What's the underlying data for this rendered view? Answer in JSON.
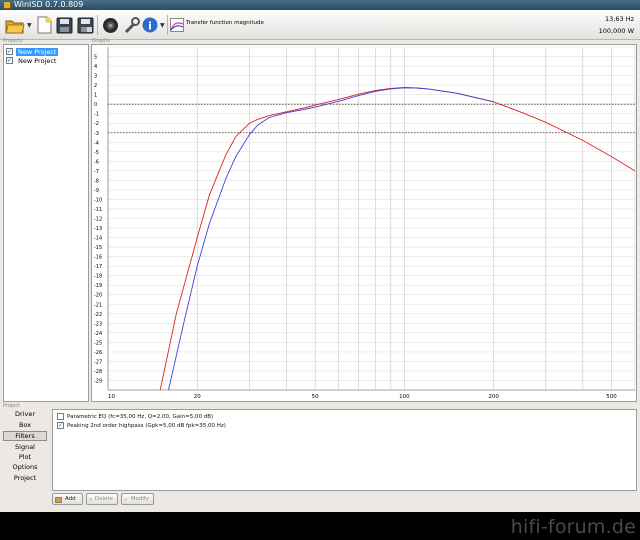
{
  "window": {
    "title": "WinISD 0.7.0.809"
  },
  "toolbar": {
    "plot_label": "Transfer function magnitude",
    "readout_freq": "13,63 Hz",
    "readout_power": "100,000 W",
    "icons": [
      "open-folder-icon",
      "new-file-icon",
      "save-icon",
      "save-all-icon",
      "driver-icon",
      "tools-icon",
      "info-icon",
      "plot-icon"
    ]
  },
  "projects": {
    "group_label": "Projects",
    "items": [
      {
        "label": "New Project",
        "checked": true,
        "selected": true
      },
      {
        "label": "New Project",
        "checked": true,
        "selected": false
      }
    ]
  },
  "graph": {
    "group_label": "Graphs"
  },
  "project_panel": {
    "group_label": "Project",
    "nav": [
      "Driver",
      "Box",
      "Filters",
      "Signal",
      "Plot",
      "Options",
      "Project"
    ],
    "selected_nav": "Filters",
    "filters": [
      {
        "label": "Parametric EQ (fc=35,00 Hz, Q=2,00, Gain=5,00 dB)",
        "checked": false
      },
      {
        "label": "Peaking 2nd order highpass (Gpk=5,00 dB fpk=35,00 Hz)",
        "checked": true
      }
    ],
    "buttons": {
      "add": "Add",
      "delete": "Delete",
      "modify": "Modify"
    }
  },
  "watermark": "hifi-forum.de",
  "chart_data": {
    "type": "line",
    "title": "Transfer function magnitude",
    "x_scale": "log",
    "xlim": [
      10,
      600
    ],
    "ylim": [
      -30,
      6
    ],
    "x_ticks": [
      10,
      20,
      50,
      100,
      200,
      500
    ],
    "y_ticks": [
      5,
      4,
      3,
      2,
      1,
      0,
      -1,
      -2,
      -3,
      -4,
      -5,
      -6,
      -7,
      -8,
      -9,
      -10,
      -11,
      -12,
      -13,
      -14,
      -15,
      -16,
      -17,
      -18,
      -19,
      -20,
      -21,
      -22,
      -23,
      -24,
      -25,
      -26,
      -27,
      -28,
      -29
    ],
    "reference_lines": [
      0,
      -3
    ],
    "grid": true,
    "series": [
      {
        "color": "#e02020",
        "x": [
          15,
          17,
          20,
          22,
          25,
          27,
          30,
          32,
          35,
          40,
          45,
          50,
          60,
          70,
          80,
          90,
          100,
          110,
          120,
          150,
          200,
          250,
          300,
          400,
          500,
          600
        ],
        "y": [
          -30,
          -22,
          -14,
          -9.5,
          -5.3,
          -3.4,
          -2,
          -1.6,
          -1.2,
          -0.8,
          -0.45,
          -0.1,
          0.5,
          1.05,
          1.45,
          1.65,
          1.75,
          1.7,
          1.6,
          1.15,
          0.25,
          -0.9,
          -1.9,
          -3.8,
          -5.5,
          -7
        ]
      },
      {
        "color": "#4040e0",
        "x": [
          16,
          18,
          20,
          22,
          25,
          27,
          30,
          32,
          35,
          40,
          45,
          50,
          60,
          70,
          80,
          90,
          100,
          110,
          120,
          150,
          200
        ],
        "y": [
          -30,
          -23,
          -17,
          -12.5,
          -7.8,
          -5.5,
          -3.2,
          -2.2,
          -1.4,
          -0.9,
          -0.6,
          -0.3,
          0.3,
          0.9,
          1.35,
          1.6,
          1.72,
          1.7,
          1.6,
          1.15,
          0.25
        ]
      }
    ]
  }
}
